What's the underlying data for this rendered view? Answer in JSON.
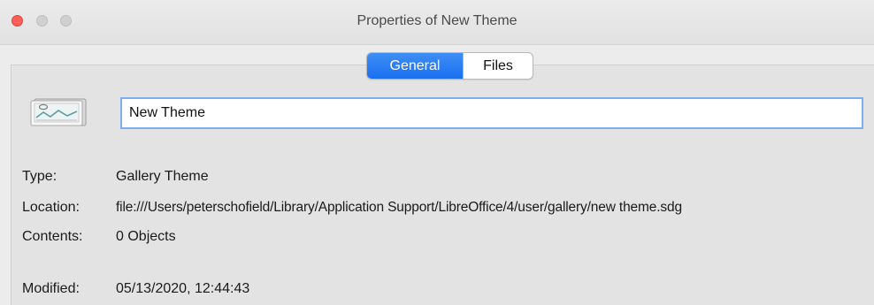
{
  "window": {
    "title": "Properties of New Theme",
    "traffic_lights": [
      "close",
      "minimize",
      "zoom"
    ],
    "colors": {
      "close": "#fc5f57",
      "inactive": "#d0d0d0",
      "accent": "#1a6ff0"
    }
  },
  "tabs": [
    {
      "label": "General",
      "active": true
    },
    {
      "label": "Files",
      "active": false
    }
  ],
  "general": {
    "icon": "gallery-theme-icon",
    "name_value": "New Theme",
    "rows": [
      {
        "label": "Type:",
        "value": "Gallery Theme"
      },
      {
        "label": "Location:",
        "value": "file:///Users/peterschofield/Library/Application Support/LibreOffice/4/user/gallery/new theme.sdg"
      },
      {
        "label": "Contents:",
        "value": "0 Objects"
      },
      {
        "label": "Modified:",
        "value": "05/13/2020, 12:44:43"
      }
    ]
  }
}
